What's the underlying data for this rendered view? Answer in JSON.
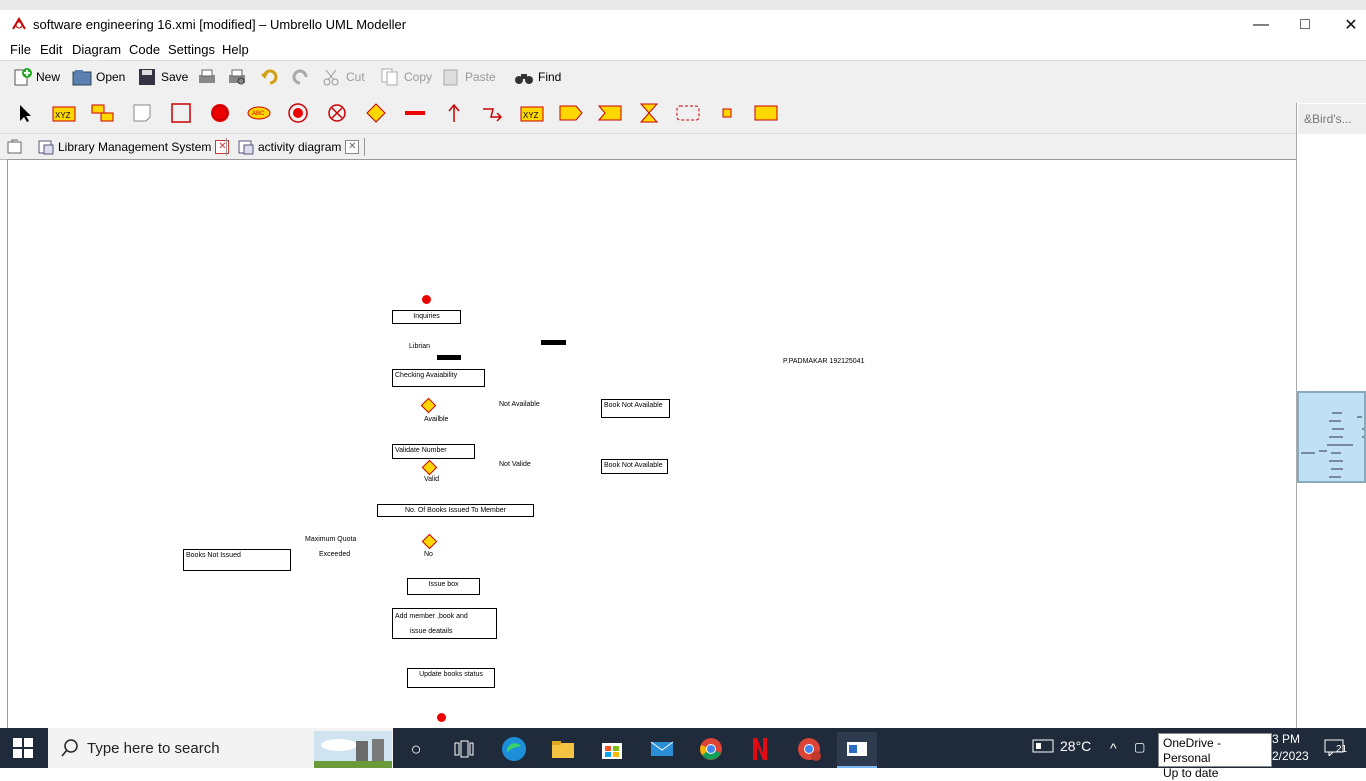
{
  "window": {
    "title": "software engineering 16.xmi [modified] – Umbrello UML Modeller",
    "minimize": "—",
    "maximize": "□",
    "close": "✕"
  },
  "menu": [
    "File",
    "Edit",
    "Diagram",
    "Code",
    "Settings",
    "Help"
  ],
  "toolbar": {
    "new": "New",
    "open": "Open",
    "save": "Save",
    "cut": "Cut",
    "copy": "Copy",
    "paste": "Paste",
    "find": "Find"
  },
  "tabs": [
    {
      "label": "Library Management System"
    },
    {
      "label": "activity diagram"
    }
  ],
  "birds_view": {
    "title": "&Bird's..."
  },
  "diagram": {
    "activities": [
      "Inquiries",
      "Checking Avaiability",
      "Book Not Available",
      "Validate Number",
      "Book Not Available",
      "No. Of Books Issued To Member",
      "Books Not Issued",
      "Issue box",
      "Add member ,book and",
      "issue deatails",
      "Update books status"
    ],
    "labels": [
      "Librian",
      "P.PADMAKAR  192125041",
      "Not Available",
      "Availble",
      "Not Valide",
      "Valid",
      "Maximum Quota",
      "Exceeded",
      "No"
    ]
  },
  "taskbar": {
    "search_placeholder": "Type here to search",
    "temperature": "28°C",
    "onedrive_line1": "OneDrive - Personal",
    "onedrive_line2": "Up to date",
    "time": "3 PM",
    "date": "2/2023",
    "notifications": "21"
  },
  "colors": {
    "accent_red": "#e00000",
    "decision_fill": "#ffd700",
    "taskbar": "#1f2a3a"
  }
}
